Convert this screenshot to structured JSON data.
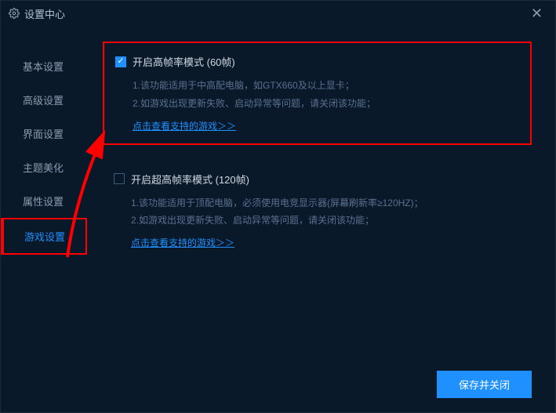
{
  "window": {
    "title": "设置中心"
  },
  "sidebar": {
    "items": [
      {
        "label": "基本设置"
      },
      {
        "label": "高级设置"
      },
      {
        "label": "界面设置"
      },
      {
        "label": "主题美化"
      },
      {
        "label": "属性设置"
      },
      {
        "label": "游戏设置"
      }
    ]
  },
  "section1": {
    "checkbox_label": "开启高帧率模式 (60帧)",
    "desc1": "1.该功能适用于中高配电脑，如GTX660及以上显卡；",
    "desc2": "2.如游戏出现更新失败、启动异常等问题，请关闭该功能；",
    "link": "点击查看支持的游戏＞＞"
  },
  "section2": {
    "checkbox_label": "开启超高帧率模式 (120帧)",
    "desc1": "1.该功能适用于顶配电脑，必须使用电竞显示器(屏幕刷新率≥120HZ)；",
    "desc2": "2.如游戏出现更新失败、启动异常等问题，请关闭该功能；",
    "link": "点击查看支持的游戏＞＞"
  },
  "footer": {
    "save_label": "保存并关闭"
  }
}
